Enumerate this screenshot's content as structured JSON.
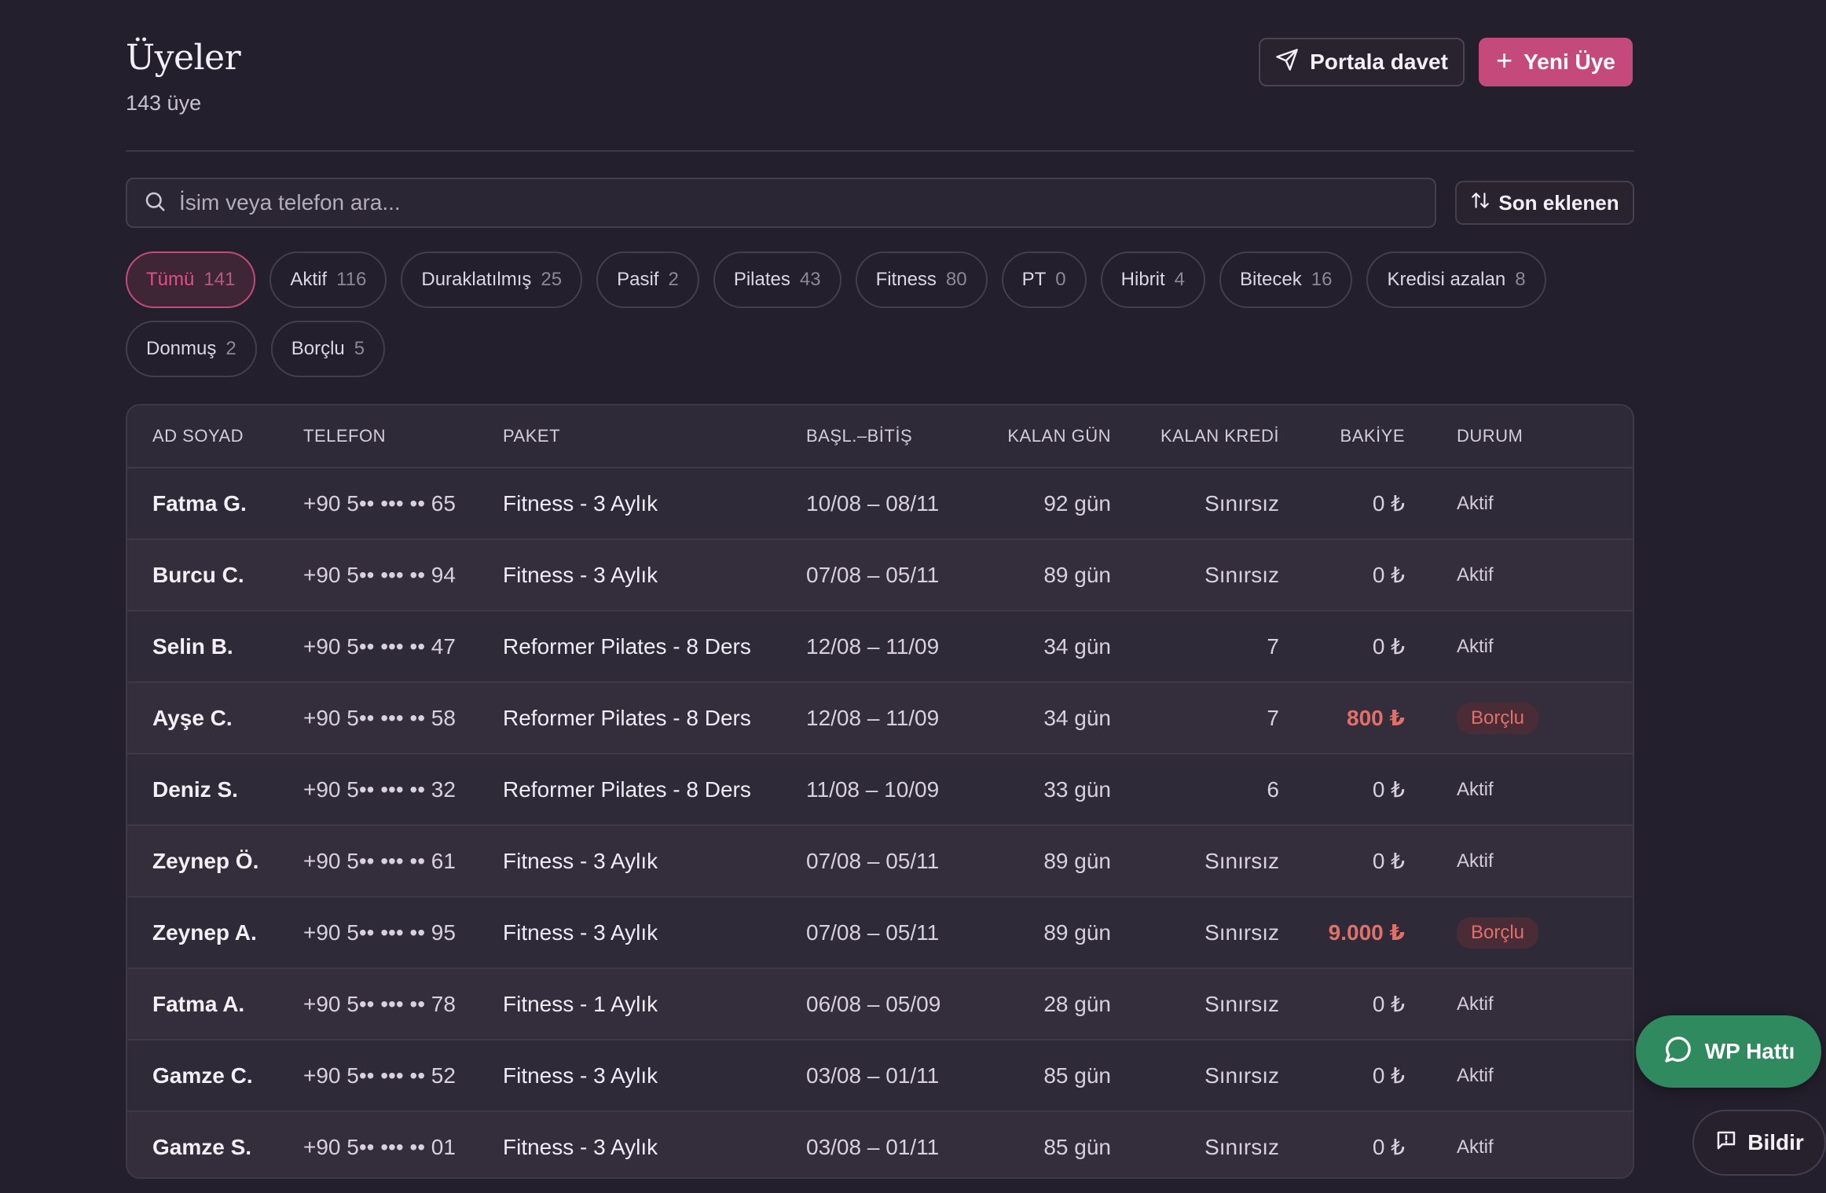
{
  "header": {
    "title": "Üyeler",
    "subtitle": "143 üye",
    "invite_label": "Portala davet",
    "new_member_label": "Yeni Üye",
    "new_member_plus": "+"
  },
  "search": {
    "placeholder": "İsim veya telefon ara...",
    "value": ""
  },
  "sort": {
    "label": "Son eklenen"
  },
  "filters": [
    {
      "label": "Tümü",
      "count": "141",
      "active": true
    },
    {
      "label": "Aktif",
      "count": "116"
    },
    {
      "label": "Duraklatılmış",
      "count": "25"
    },
    {
      "label": "Pasif",
      "count": "2"
    },
    {
      "label": "Pilates",
      "count": "43"
    },
    {
      "label": "Fitness",
      "count": "80"
    },
    {
      "label": "PT",
      "count": "0"
    },
    {
      "label": "Hibrit",
      "count": "4"
    },
    {
      "label": "Bitecek",
      "count": "16"
    },
    {
      "label": "Kredisi azalan",
      "count": "8"
    },
    {
      "label": "Donmuş",
      "count": "2"
    },
    {
      "label": "Borçlu",
      "count": "5"
    }
  ],
  "table": {
    "columns": {
      "name": "AD SOYAD",
      "phone": "TELEFON",
      "package": "PAKET",
      "dates": "BAŞL.–BİTİŞ",
      "days_left": "KALAN GÜN",
      "credits_left": "KALAN KREDİ",
      "balance": "BAKİYE",
      "status": "DURUM"
    },
    "rows": [
      {
        "name": "Fatma G.",
        "phone": "+90 5•• ••• •• 65",
        "package": "Fitness - 3 Aylık",
        "dates": "10/08 – 08/11",
        "days_left": "92 gün",
        "credits_left": "Sınırsız",
        "balance": "0 ₺",
        "status": "Aktif"
      },
      {
        "name": "Burcu C.",
        "phone": "+90 5•• ••• •• 94",
        "package": "Fitness - 3 Aylık",
        "dates": "07/08 – 05/11",
        "days_left": "89 gün",
        "credits_left": "Sınırsız",
        "balance": "0 ₺",
        "status": "Aktif"
      },
      {
        "name": "Selin B.",
        "phone": "+90 5•• ••• •• 47",
        "package": "Reformer Pilates - 8 Ders",
        "dates": "12/08 – 11/09",
        "days_left": "34 gün",
        "credits_left": "7",
        "balance": "0 ₺",
        "status": "Aktif"
      },
      {
        "name": "Ayşe C.",
        "phone": "+90 5•• ••• •• 58",
        "package": "Reformer Pilates - 8 Ders",
        "dates": "12/08 – 11/09",
        "days_left": "34 gün",
        "credits_left": "7",
        "balance": "800 ₺",
        "status": "Borçlu",
        "debt": true
      },
      {
        "name": "Deniz S.",
        "phone": "+90 5•• ••• •• 32",
        "package": "Reformer Pilates - 8 Ders",
        "dates": "11/08 – 10/09",
        "days_left": "33 gün",
        "credits_left": "6",
        "balance": "0 ₺",
        "status": "Aktif"
      },
      {
        "name": "Zeynep Ö.",
        "phone": "+90 5•• ••• •• 61",
        "package": "Fitness - 3 Aylık",
        "dates": "07/08 – 05/11",
        "days_left": "89 gün",
        "credits_left": "Sınırsız",
        "balance": "0 ₺",
        "status": "Aktif"
      },
      {
        "name": "Zeynep A.",
        "phone": "+90 5•• ••• •• 95",
        "package": "Fitness - 3 Aylık",
        "dates": "07/08 – 05/11",
        "days_left": "89 gün",
        "credits_left": "Sınırsız",
        "balance": "9.000 ₺",
        "status": "Borçlu",
        "debt": true
      },
      {
        "name": "Fatma A.",
        "phone": "+90 5•• ••• •• 78",
        "package": "Fitness - 1 Aylık",
        "dates": "06/08 – 05/09",
        "days_left": "28 gün",
        "credits_left": "Sınırsız",
        "balance": "0 ₺",
        "status": "Aktif"
      },
      {
        "name": "Gamze C.",
        "phone": "+90 5•• ••• •• 52",
        "package": "Fitness - 3 Aylık",
        "dates": "03/08 – 01/11",
        "days_left": "85 gün",
        "credits_left": "Sınırsız",
        "balance": "0 ₺",
        "status": "Aktif"
      },
      {
        "name": "Gamze S.",
        "phone": "+90 5•• ••• •• 01",
        "package": "Fitness - 3 Aylık",
        "dates": "03/08 – 01/11",
        "days_left": "85 gün",
        "credits_left": "Sınırsız",
        "balance": "0 ₺",
        "status": "Aktif"
      }
    ]
  },
  "floating": {
    "whatsapp_label": "WP Hattı",
    "report_label": "Bildir"
  },
  "icons": {
    "invite": "send-icon",
    "new": "plus-icon",
    "search": "search-icon",
    "sort": "sort-arrows-icon",
    "whatsapp": "chat-bubble-icon",
    "report": "message-alert-icon"
  },
  "colors": {
    "background": "#231f2c",
    "accent": "#c44a7b",
    "debt": "#e0706a",
    "whatsapp": "#2f8a5f"
  }
}
